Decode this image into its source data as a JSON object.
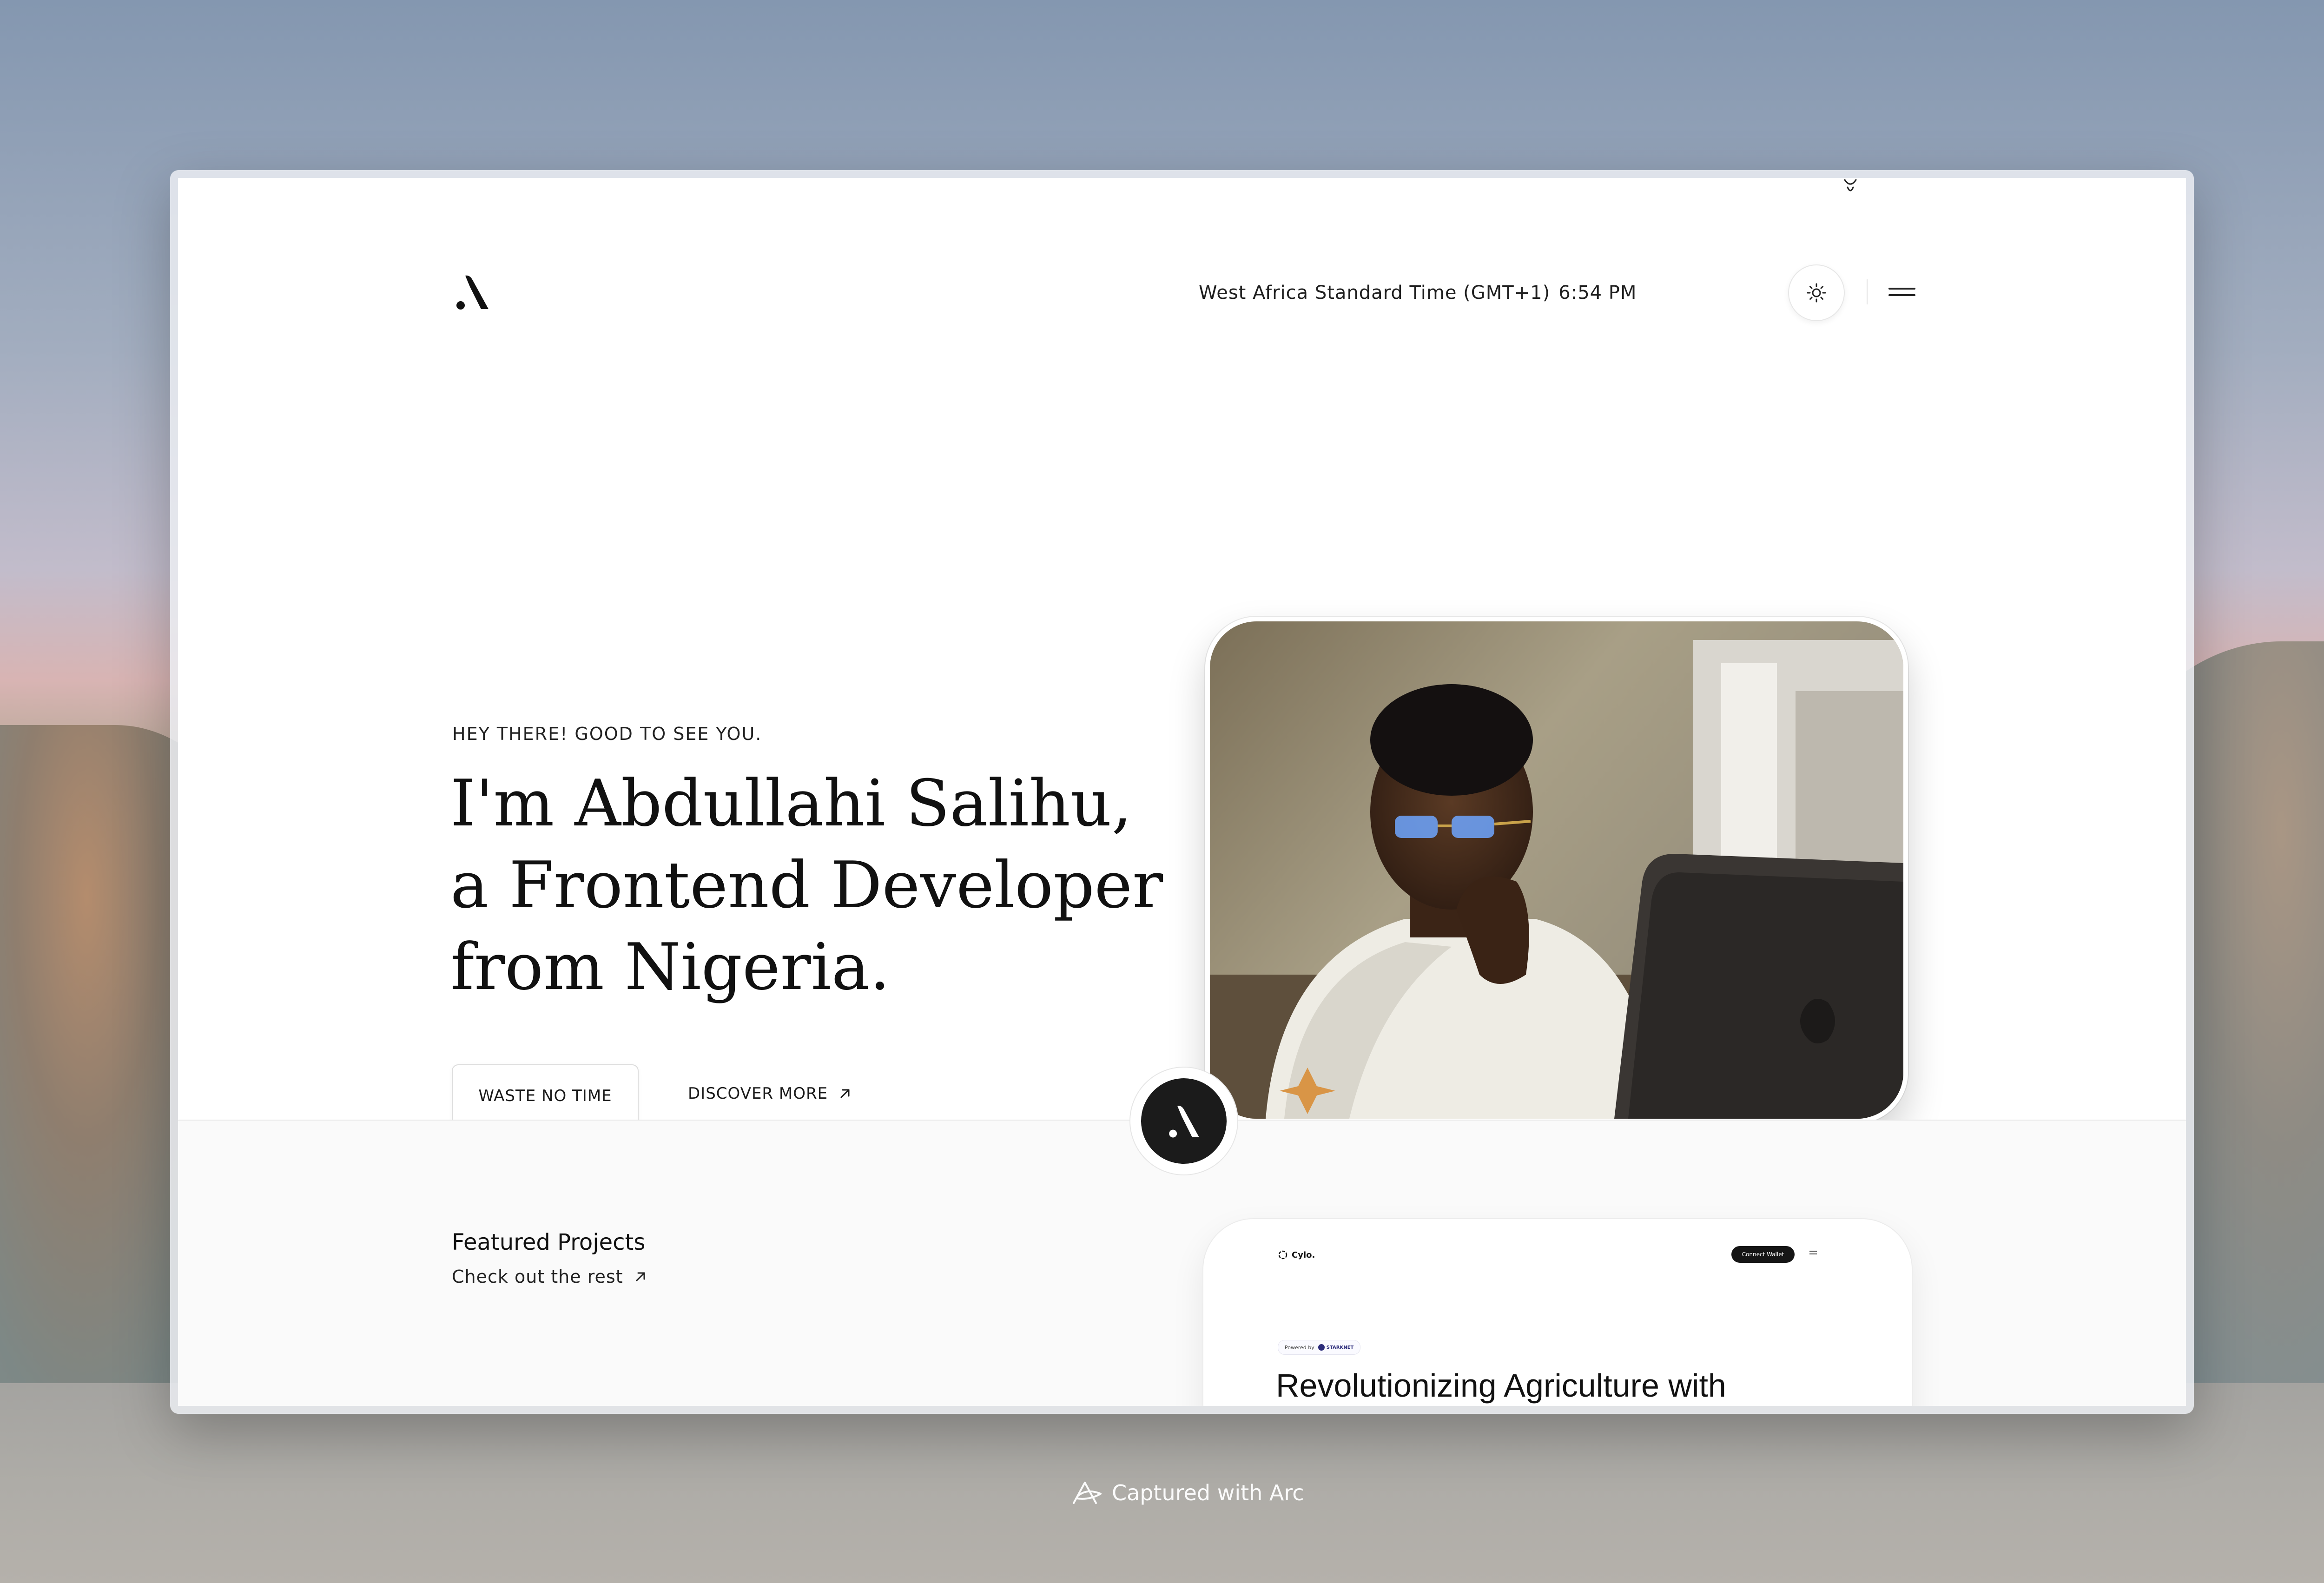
{
  "header": {
    "timezone": "West Africa Standard Time (GMT+1)",
    "clock": "6:54 PM",
    "theme_icon": "sun-icon",
    "menu_icon": "hamburger-menu-icon",
    "logo_icon": "monogram-logo-icon"
  },
  "hero": {
    "eyebrow": "HEY THERE! GOOD TO SEE YOU.",
    "headline_lines": [
      "I'm Abdullahi Salihu,",
      "a Frontend Developer",
      "from Nigeria."
    ],
    "primary_button": "WASTE NO TIME",
    "secondary_link": "DISCOVER MORE",
    "secondary_link_icon": "arrow-up-right-icon",
    "photo_icon": "portrait-photo"
  },
  "featured": {
    "title": "Featured Projects",
    "link": "Check out the rest",
    "link_icon": "arrow-up-right-icon"
  },
  "project_preview": {
    "brand": "Cylo.",
    "connect_button": "Connect Wallet",
    "powered_by": "Powered by",
    "powered_brand": "STARKNET",
    "headline": "Revolutionizing Agriculture with"
  },
  "footer_caption": {
    "text": "Captured with Arc",
    "icon": "arc-logo-icon"
  },
  "colors": {
    "page_background": "#ffffff",
    "section_background": "#fafafa",
    "text_primary": "#111111",
    "badge_dark": "#1b1b1b"
  }
}
